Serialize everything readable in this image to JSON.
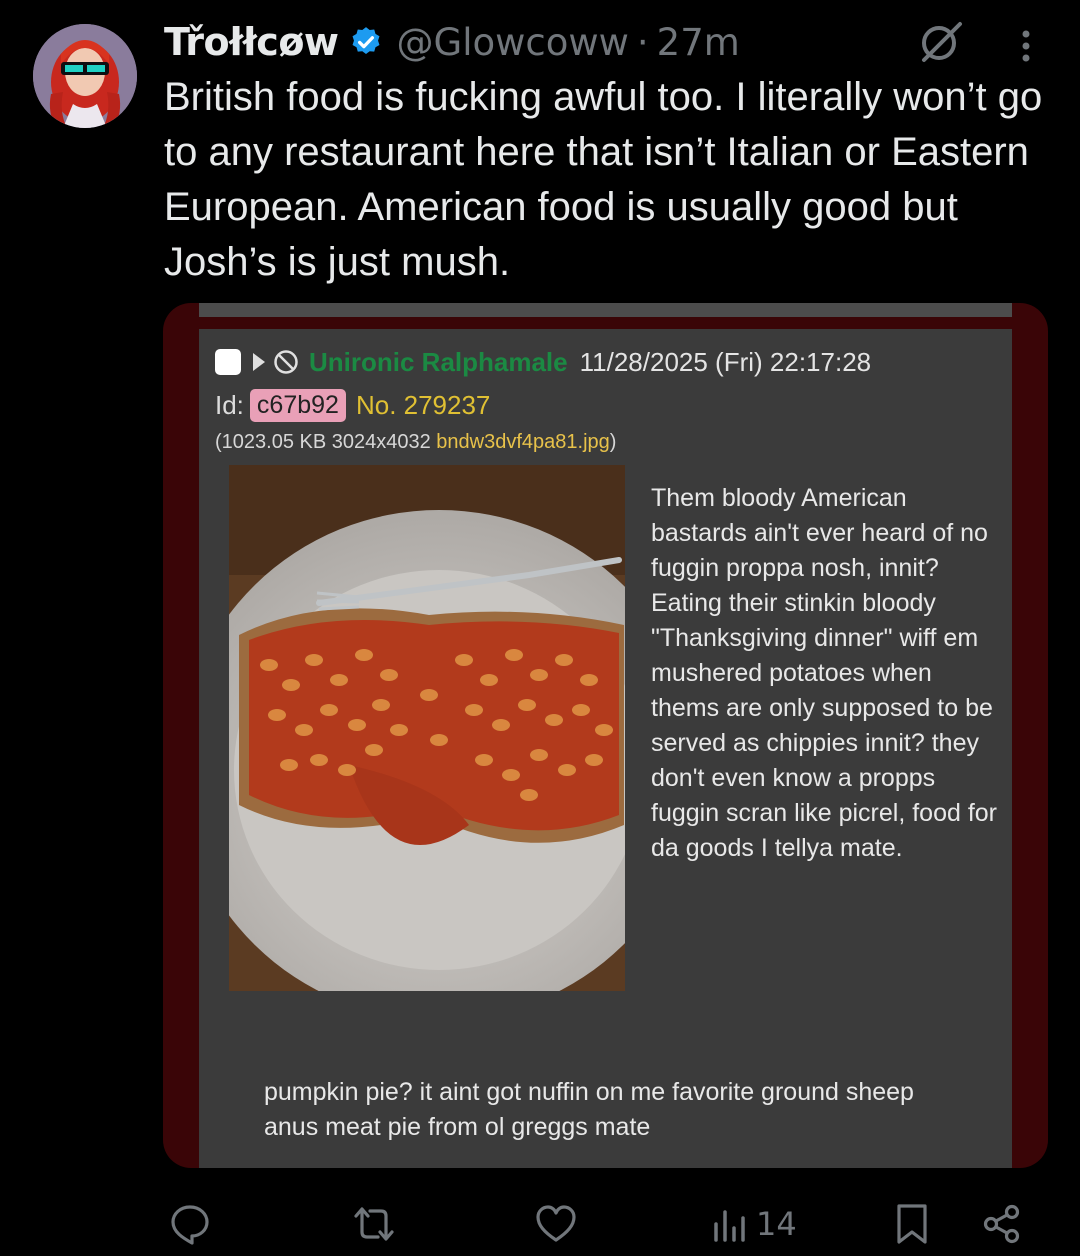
{
  "tweet": {
    "display_name": "Třołłcøw",
    "handle": "@Glowcoww",
    "separator": "·",
    "time": "27m",
    "text": "British food is fucking awful too. I literally won’t go to any restaurant here that isn’t Italian or Eastern European. American food is usually good but Josh’s is just mush."
  },
  "embedded_post": {
    "poster_name": "Unironic Ralphamale",
    "date": "11/28/2025 (Fri) 22:17:28",
    "id_label": "Id:",
    "id_value": "c67b92",
    "post_number": "No. 279237",
    "file_info_prefix": "(1023.05 KB 3024x4032 ",
    "file_name": "bndw3dvf4pa81.jpg",
    "file_info_suffix": ")",
    "body": "Them bloody American bastards ain't ever heard of no fuggin proppa nosh, innit? Eating their stinkin bloody \"Thanksgiving dinner\" wiff em mushered potatoes when thems are only supposed to be served as chippies innit? they don't even know a propps fuggin scran like picrel, food for da goods I tellya mate.",
    "tail": "pumpkin pie? it aint got nuffin on me favorite ground sheep anus meat pie from ol greggs mate"
  },
  "actions": {
    "views": "14"
  },
  "icons": {
    "verified": "verified-badge-icon",
    "grok": "grok-icon",
    "more": "more-icon",
    "reply": "reply-icon",
    "repost": "repost-icon",
    "like": "like-icon",
    "views": "views-icon",
    "bookmark": "bookmark-icon",
    "share": "share-icon"
  },
  "colors": {
    "background": "#000000",
    "text": "#e7e9ea",
    "muted": "#71767b",
    "verified": "#1d9bf0",
    "poster_name": "#1b8a43",
    "post_number": "#e0c033",
    "id_badge": "#e9a0b7"
  }
}
